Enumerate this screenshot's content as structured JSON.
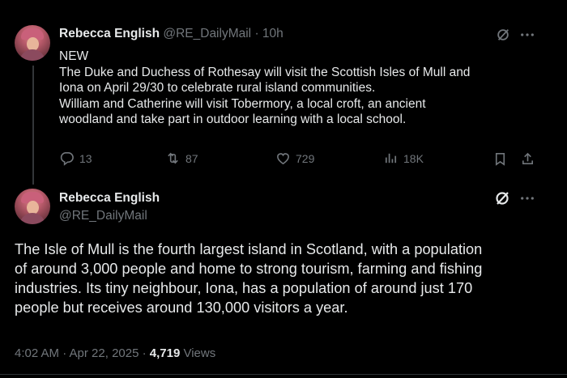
{
  "colors": {
    "background": "#000000",
    "text": "#e7e9ea",
    "muted": "#71767b",
    "divider": "#2f3336"
  },
  "tweet1": {
    "author_name": "Rebecca English",
    "author_handle": "@RE_DailyMail",
    "separator": "·",
    "time": "10h",
    "lines": [
      "NEW",
      "The Duke and Duchess of Rothesay will visit the Scottish Isles of Mull and",
      "Iona on April 29/30 to celebrate rural island communities.",
      "William and Catherine will visit Tobermory, a local croft, an ancient",
      "woodland and take part in outdoor learning with a local school."
    ],
    "replies": "13",
    "reposts": "87",
    "likes": "729",
    "views": "18K"
  },
  "tweet2": {
    "author_name": "Rebecca English",
    "author_handle": "@RE_DailyMail",
    "lines": [
      "The Isle of Mull is the fourth largest island in Scotland, with a population",
      "of around 3,000 people and home to strong tourism, farming and fishing",
      "industries. Its tiny neighbour, Iona, has a population of around just 170",
      "people but receives around 130,000 visitors a year."
    ],
    "timestamp": "4:02 AM · Apr 22, 2025 · ",
    "views_count": "4,719",
    "views_label": " Views"
  },
  "icons": {
    "grok": "grok-icon",
    "more": "more-icon",
    "reply": "reply-icon",
    "repost": "repost-icon",
    "like": "like-icon",
    "views": "views-icon",
    "bookmark": "bookmark-icon",
    "share": "share-icon"
  }
}
